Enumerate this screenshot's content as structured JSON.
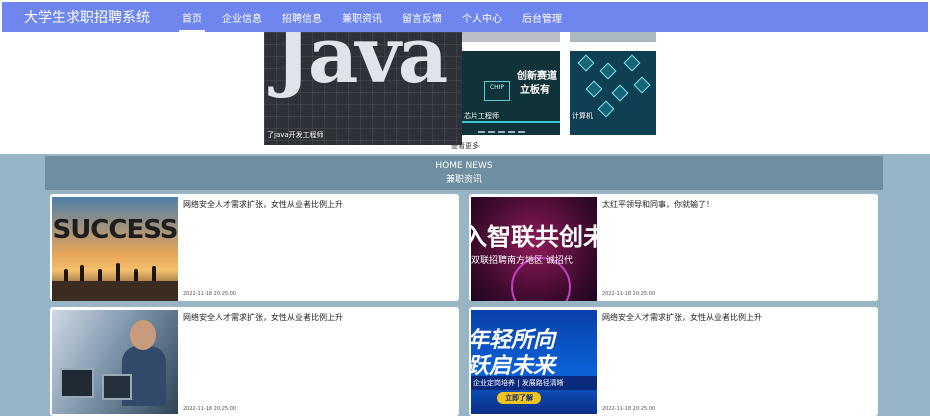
{
  "nav": {
    "brand": "大学生求职招聘系统",
    "items": [
      {
        "label": "首页",
        "active": true
      },
      {
        "label": "企业信息"
      },
      {
        "label": "招聘信息"
      },
      {
        "label": "兼职资讯"
      },
      {
        "label": "留言反馈"
      },
      {
        "label": "个人中心"
      },
      {
        "label": "后台管理"
      }
    ]
  },
  "carousel": {
    "big_caption": "了java开发工程师",
    "big_word": "Java",
    "thumb1_caption": "芯片工程师",
    "thumb1_line1": "创新赛道",
    "thumb1_line2": "立板有",
    "thumb1_chip": "CHIP",
    "thumb2_caption": "计算机",
    "more": "查看更多"
  },
  "news": {
    "title_en": "HOME NEWS",
    "title_cn": "兼职资讯",
    "items": [
      {
        "title": "网络安全人才需求扩张，女性从业者比例上升",
        "date": "2022-11-18 20:25:00",
        "image": "success-image",
        "image_text": "SUCCESS"
      },
      {
        "title": "太红平领导和同事，你就输了！",
        "date": "2022-11-18 20:25:00",
        "image": "red-banner-image",
        "image_text": "入智联共创未",
        "image_subtext": "双联招聘南方地区 诚招代"
      },
      {
        "title": "网络安全人才需求扩张，女性从业者比例上升",
        "date": "2022-11-18 20:25:00",
        "image": "office-image"
      },
      {
        "title": "网络安全人才需求扩张，女性从业者比例上升",
        "date": "2022-11-18 20:25:00",
        "image": "blue-banner-image",
        "image_text_1": "年轻所向",
        "image_text_2": "跃启未来",
        "image_text_3": "企业定岗培养 | 发展路径清晰",
        "image_button": "立即了解"
      }
    ]
  },
  "colors": {
    "nav": "#6f86ee",
    "section_bg": "#98b5c6",
    "section_header": "#6e8fa1"
  }
}
